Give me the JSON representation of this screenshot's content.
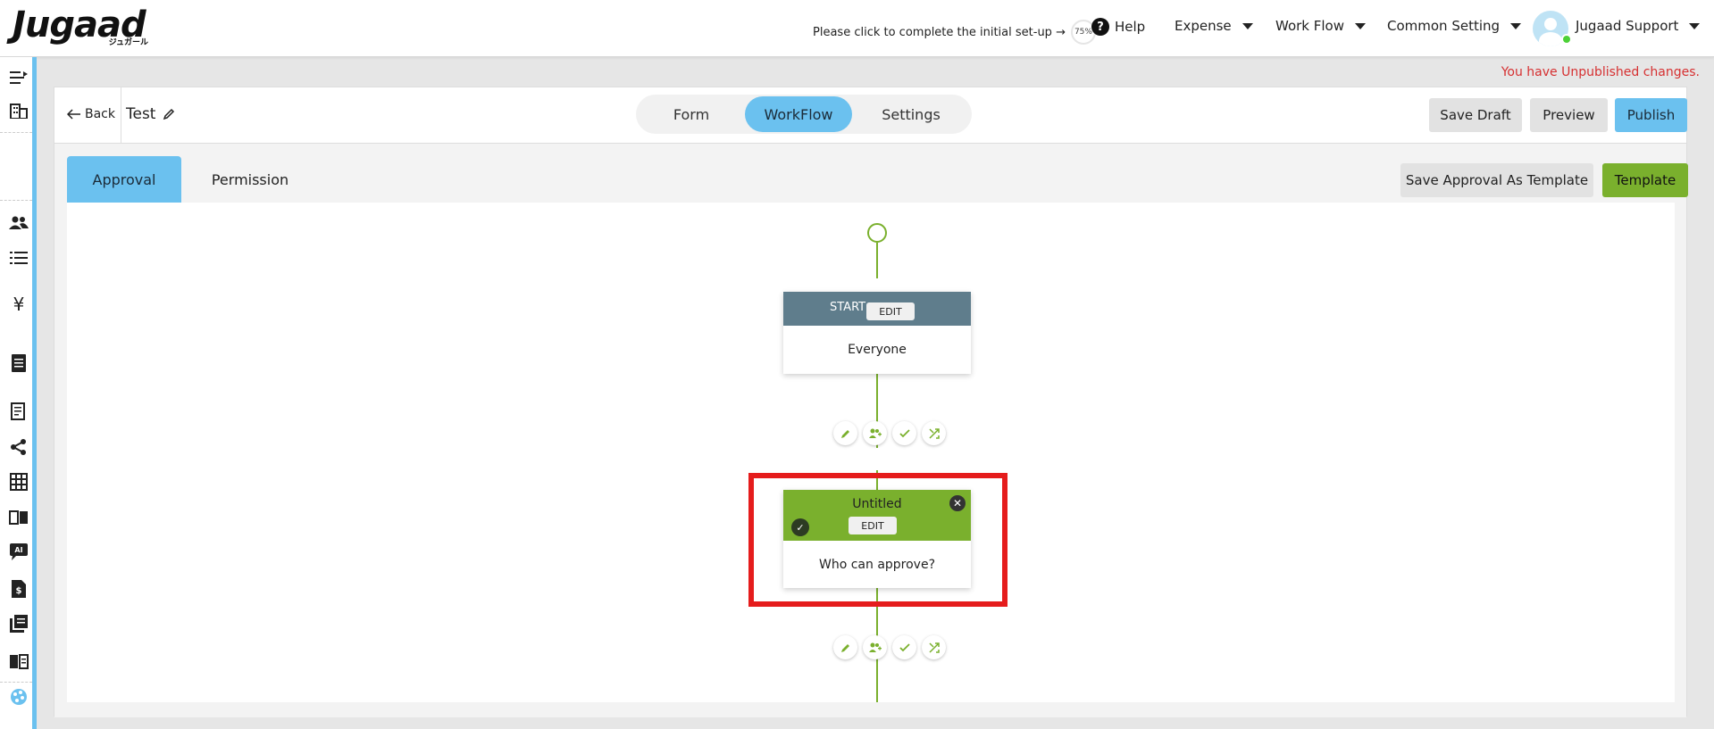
{
  "header": {
    "logo_main": "Jugaad",
    "logo_sub": "ジュガール",
    "setup_text": "Please click to complete the initial set-up →",
    "setup_progress": "75%",
    "help_label": "Help",
    "nav": [
      "Expense",
      "Work Flow",
      "Common Setting"
    ],
    "user_name": "Jugaad Support"
  },
  "notice": "You have Unpublished changes.",
  "toolbar": {
    "back_label": "Back",
    "doc_title": "Test",
    "tabs": [
      "Form",
      "WorkFlow",
      "Settings"
    ],
    "active_tab": "WorkFlow",
    "save_draft": "Save Draft",
    "preview": "Preview",
    "publish": "Publish"
  },
  "subtabs": {
    "approval": "Approval",
    "permission": "Permission",
    "save_template": "Save Approval As Template",
    "template": "Template"
  },
  "flow": {
    "start_node": {
      "title": "START",
      "edit": "EDIT",
      "body": "Everyone"
    },
    "approval_node": {
      "title": "Untitled",
      "edit": "EDIT",
      "body": "Who can approve?"
    }
  },
  "colors": {
    "accent_blue": "#6bc1ef",
    "accent_green": "#7ab02d",
    "start_header": "#5f7d8c",
    "alert_red": "#d63031",
    "highlight_red": "#e51c1c"
  }
}
